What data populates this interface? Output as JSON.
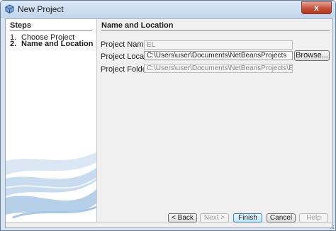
{
  "window": {
    "title": "New Project",
    "close_glyph": "x"
  },
  "steps": {
    "heading": "Steps",
    "items": [
      {
        "number": "1.",
        "label": "Choose Project"
      },
      {
        "number": "2.",
        "label": "Name and Location"
      }
    ],
    "current_index": 1
  },
  "main": {
    "heading": "Name and Location",
    "project_name": {
      "label": "Project Name:",
      "value": "EL"
    },
    "project_location": {
      "label": "Project Location:",
      "value": "C:\\Users\\user\\Documents\\NetBeansProjects"
    },
    "project_folder": {
      "label": "Project Folder:",
      "value": "C:\\Users\\user\\Documents\\NetBeansProjects\\EL"
    },
    "browse_label": "Browse..."
  },
  "footer": {
    "back_label": "< Back",
    "next_label": "Next >",
    "finish_label": "Finish",
    "cancel_label": "Cancel",
    "help_label": "Help"
  },
  "colors": {
    "title_bar": "#c3d6ec",
    "close_button": "#c5513c",
    "dialog_background": "#f0f0f0",
    "default_button": "#bee6fd"
  }
}
